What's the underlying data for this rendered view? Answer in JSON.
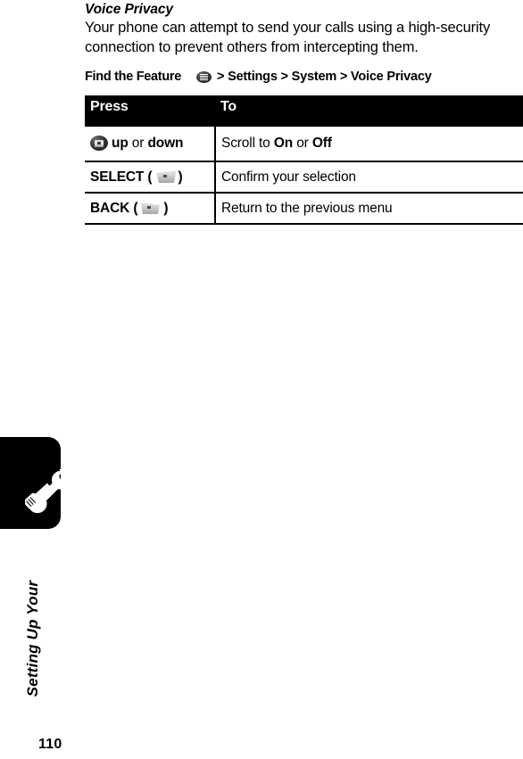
{
  "page": {
    "number": "110",
    "chapter_title": "Setting Up Your",
    "chapter_tab_icon": "tools-icon"
  },
  "section": {
    "heading": "Voice Privacy",
    "paragraph": "Your phone can attempt to send your calls using a high-security connection to prevent others from intercepting them."
  },
  "find_the_feature": {
    "label": "Find the Feature",
    "menu_icon": "menu-key-icon",
    "path": "> Settings > System > Voice Privacy"
  },
  "table": {
    "headers": {
      "press": "Press",
      "to": "To"
    },
    "rows": [
      {
        "press_icon": "nav-key-icon",
        "press_prefix": "",
        "press_bold_1": "up",
        "press_conjunction": " or ",
        "press_bold_2": "down",
        "press_suffix": "",
        "to_prefix": "Scroll to ",
        "to_bold_1": "On",
        "to_middle": " or ",
        "to_bold_2": "Off",
        "to_suffix": ""
      },
      {
        "press_icon": "soft-key-left-icon",
        "press_label": "SELECT",
        "press_open_paren": "(",
        "press_close_paren": ")",
        "to_text": "Confirm your selection"
      },
      {
        "press_icon": "soft-key-right-icon",
        "press_label": "BACK",
        "press_open_paren": "(",
        "press_close_paren": ")",
        "to_text": "Return to the previous menu"
      }
    ]
  },
  "colors": {
    "page_background": "#ffffff",
    "text": "#000000",
    "table_header_background": "#000000",
    "table_header_text": "#ffffff",
    "tab_background": "#000000"
  }
}
